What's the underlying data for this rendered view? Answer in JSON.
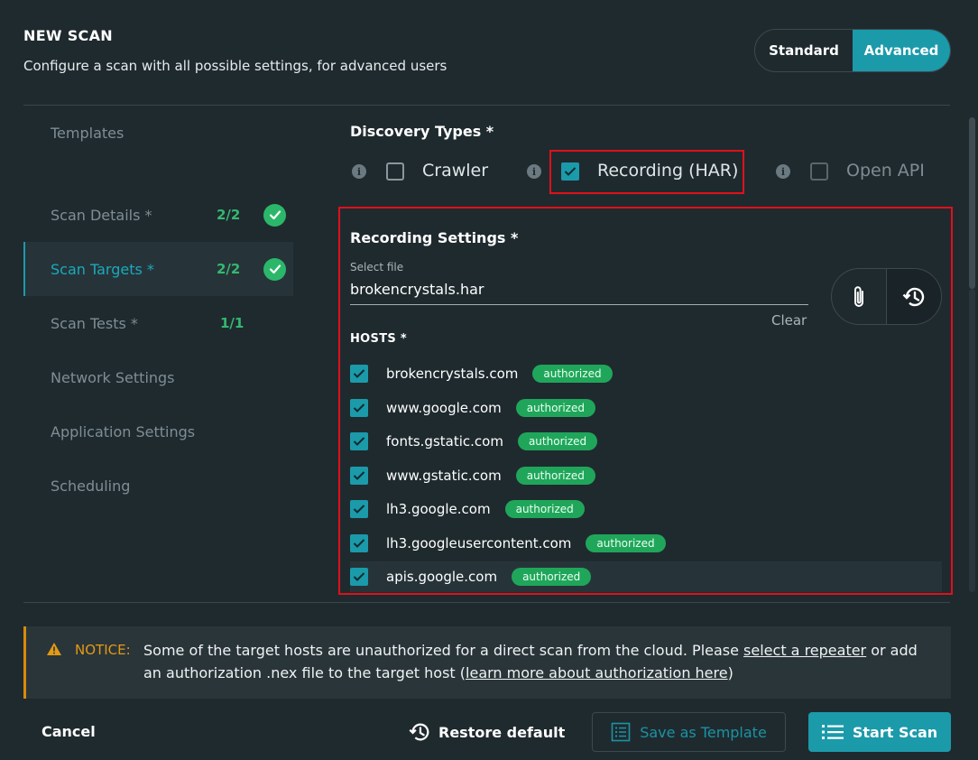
{
  "header": {
    "title": "NEW SCAN",
    "subtitle": "Configure a scan with all possible settings, for advanced users",
    "modes": [
      "Standard",
      "Advanced"
    ],
    "active_mode": "Advanced"
  },
  "nav": {
    "items": [
      {
        "label": "Templates",
        "count": "",
        "complete": false
      },
      {
        "label": "Scan Details *",
        "count": "2/2",
        "complete": true
      },
      {
        "label": "Scan Targets *",
        "count": "2/2",
        "complete": true,
        "active": true
      },
      {
        "label": "Scan Tests *",
        "count": "1/1",
        "complete": false
      },
      {
        "label": "Network Settings",
        "count": "",
        "complete": false
      },
      {
        "label": "Application Settings",
        "count": "",
        "complete": false
      },
      {
        "label": "Scheduling",
        "count": "",
        "complete": false
      }
    ]
  },
  "discovery": {
    "title": "Discovery Types *",
    "options": [
      {
        "label": "Crawler",
        "checked": false,
        "enabled": true
      },
      {
        "label": "Recording (HAR)",
        "checked": true,
        "enabled": true
      },
      {
        "label": "Open API",
        "checked": false,
        "enabled": false
      }
    ]
  },
  "recording": {
    "title": "Recording Settings *",
    "file_caption": "Select file",
    "file_value": "brokencrystals.har",
    "clear_label": "Clear",
    "hosts_title": "HOSTS *",
    "hosts": [
      {
        "name": "brokencrystals.com",
        "badge": "authorized",
        "checked": true
      },
      {
        "name": "www.google.com",
        "badge": "authorized",
        "checked": true
      },
      {
        "name": "fonts.gstatic.com",
        "badge": "authorized",
        "checked": true
      },
      {
        "name": "www.gstatic.com",
        "badge": "authorized",
        "checked": true
      },
      {
        "name": "lh3.google.com",
        "badge": "authorized",
        "checked": true
      },
      {
        "name": "lh3.googleusercontent.com",
        "badge": "authorized",
        "checked": true
      },
      {
        "name": "apis.google.com",
        "badge": "authorized",
        "checked": true
      }
    ]
  },
  "notice": {
    "tag": "NOTICE:",
    "text_1": "Some of the target hosts are unauthorized for a direct scan from the cloud. Please ",
    "link_1": "select a repeater",
    "text_2": " or add an authorization .nex file to the target host (",
    "link_2": "learn more about authorization here",
    "text_3": ")"
  },
  "footer": {
    "cancel": "Cancel",
    "restore": "Restore default",
    "save_template": "Save as Template",
    "start_scan": "Start Scan"
  },
  "colors": {
    "accent": "#1b9aaa",
    "success": "#20a65a",
    "warning": "#e39a14",
    "highlight_box": "#e0101a",
    "background": "#1f2a2f"
  }
}
